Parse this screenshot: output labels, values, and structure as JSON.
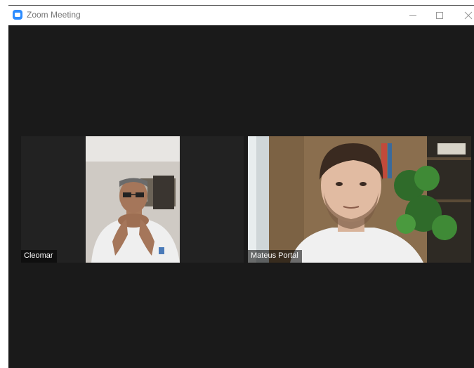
{
  "window": {
    "title": "Zoom Meeting",
    "app_icon": "zoom-logo-icon",
    "controls": [
      "minimize-icon",
      "maximize-icon",
      "close-icon"
    ]
  },
  "participants": [
    {
      "name": "Cleomar"
    },
    {
      "name": "Mateus Portal"
    }
  ],
  "colors": {
    "stage_background": "#1a1a1a",
    "zoom_blue": "#2d8cff",
    "titlebar_text": "#777777"
  }
}
